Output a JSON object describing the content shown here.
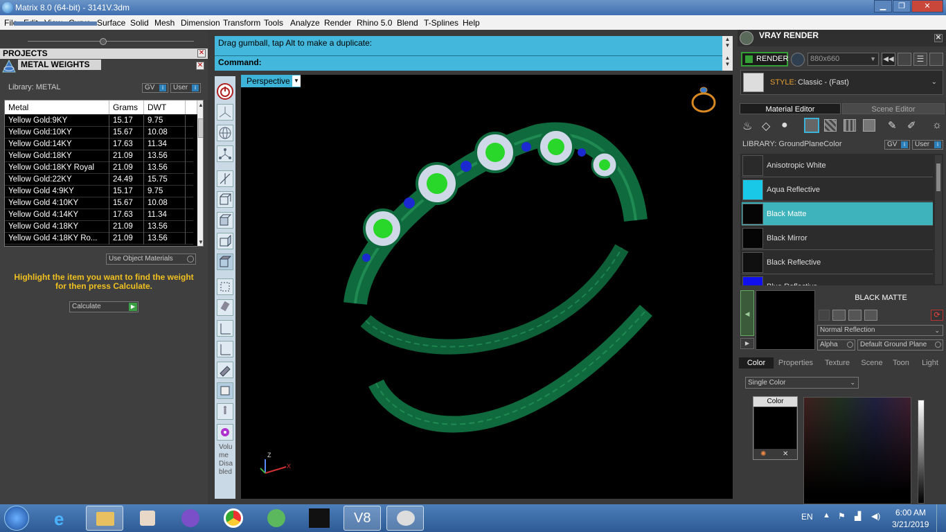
{
  "window": {
    "title": "Matrix 8.0 (64-bit) - 3141V.3dm",
    "min": "▁",
    "max": "❐",
    "close": "✕"
  },
  "menu": [
    "File",
    "Edit",
    "View",
    "Curve",
    "Surface",
    "Solid",
    "Mesh",
    "Dimension",
    "Transform",
    "Tools",
    "Analyze",
    "Render",
    "Rhino 5.0",
    "Blend",
    "T-Splines",
    "Help"
  ],
  "left": {
    "projects_title": "PROJECTS",
    "metal_title": "METAL WEIGHTS",
    "library": "Library: METAL",
    "gv_label": "GV",
    "user_label": "User",
    "columns": [
      "Metal",
      "Grams",
      "DWT"
    ],
    "rows": [
      [
        "Yellow Gold:9KY",
        "15.17",
        "9.75"
      ],
      [
        "Yellow Gold:10KY",
        "15.67",
        "10.08"
      ],
      [
        "Yellow Gold:14KY",
        "17.63",
        "11.34"
      ],
      [
        "Yellow Gold:18KY",
        "21.09",
        "13.56"
      ],
      [
        "Yellow Gold:18KY Royal",
        "21.09",
        "13.56"
      ],
      [
        "Yellow Gold:22KY",
        "24.49",
        "15.75"
      ],
      [
        "Yellow Gold 4:9KY",
        "15.17",
        "9.75"
      ],
      [
        "Yellow Gold 4:10KY",
        "15.67",
        "10.08"
      ],
      [
        "Yellow Gold 4:14KY",
        "17.63",
        "11.34"
      ],
      [
        "Yellow Gold 4:18KY",
        "21.09",
        "13.56"
      ],
      [
        "Yellow Gold 4:18KY Ro...",
        "21.09",
        "13.56"
      ]
    ],
    "use_object_materials": "Use Object Materials",
    "hint": "Highlight the item you want to find the weight for then press Calculate.",
    "calculate": "Calculate"
  },
  "command": {
    "line1": "Drag gumball, tap Alt to make a duplicate:",
    "line2": "Command:"
  },
  "viewport": {
    "label": "Perspective",
    "volume_disabled": "Volume Disabled",
    "axis_z": "Z",
    "axis_x": "X"
  },
  "right": {
    "title": "VRAY RENDER",
    "render": "RENDER",
    "resolution": "880x660",
    "style_label": "STYLE:",
    "style_value": "Classic - (Fast)",
    "tab_material": "Material Editor",
    "tab_scene": "Scene Editor",
    "library": "LIBRARY: GroundPlaneColor",
    "materials": [
      {
        "name": "Anisotropic White",
        "color": "#2a2a2a"
      },
      {
        "name": "Aqua Reflective",
        "color": "#18c8e6"
      },
      {
        "name": "Black Matte",
        "color": "#050505"
      },
      {
        "name": "Black Mirror",
        "color": "#050505"
      },
      {
        "name": "Black Reflective",
        "color": "#101010"
      },
      {
        "name": "Blue Reflective",
        "color": "#1010ee"
      }
    ],
    "selected_material": "BLACK MATTE",
    "reflection": "Normal Reflection",
    "alpha": "Alpha",
    "ground_plane": "Default Ground Plane",
    "subtabs": [
      "Color",
      "Properties",
      "Texture",
      "Scene",
      "Toon",
      "Light"
    ],
    "color_mode": "Single Color",
    "color_label": "Color"
  },
  "taskbar": {
    "lang": "EN",
    "time": "6:00 AM",
    "date": "3/21/2019"
  },
  "colors": {
    "accent": "#44b8dc",
    "highlight": "#3fb3bb",
    "hint": "#f0c020",
    "ring": "#0f6b3e"
  }
}
